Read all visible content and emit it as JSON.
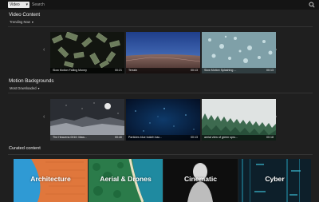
{
  "topbar": {
    "category": "Video",
    "search_placeholder": "Search"
  },
  "video_content": {
    "title": "Video Content",
    "sort": "Trending Now",
    "cards": [
      {
        "title": "Slow Motion Falling Money",
        "duration": "00:21"
      },
      {
        "title": "Terrain",
        "duration": "00:13"
      },
      {
        "title": "Slow Motion Splashing ...",
        "duration": "00:13"
      }
    ]
  },
  "motion_backgrounds": {
    "title": "Motion Backgrounds",
    "sort": "Most Downloaded",
    "cards": [
      {
        "title": "The Heavens 0010: Maw...",
        "duration": "00:40"
      },
      {
        "title": "Particles blue bokeh bac...",
        "duration": "00:13"
      },
      {
        "title": "aerial view of green spru...",
        "duration": "00:18"
      }
    ]
  },
  "curated": {
    "title": "Curated content",
    "tiles": [
      "Architecture",
      "Aerial & Drones",
      "Cinematic",
      "Cyber"
    ]
  },
  "colors": {
    "background": "#1f1f1f",
    "topbar": "#141414",
    "caption_bg": "#000000"
  }
}
